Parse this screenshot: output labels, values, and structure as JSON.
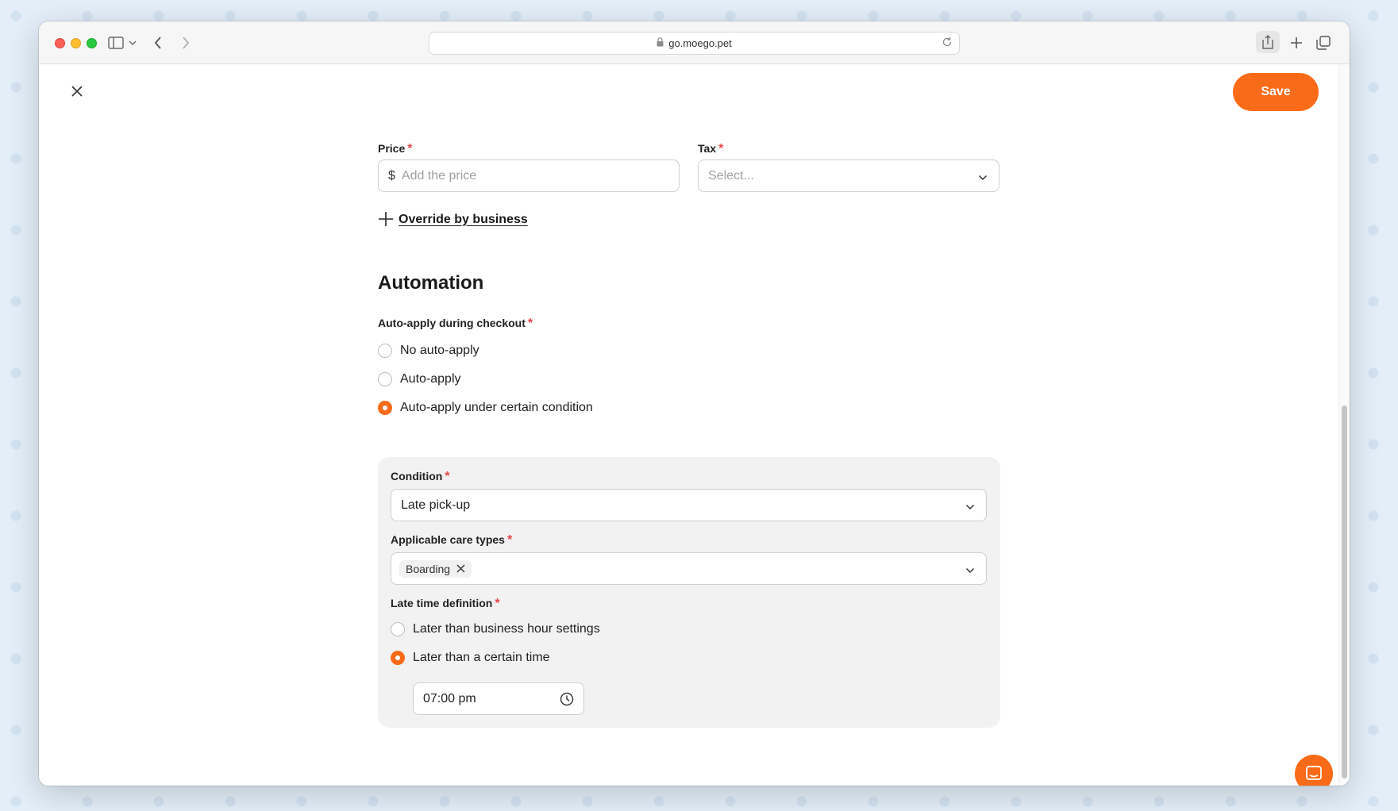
{
  "browser": {
    "url": "go.moego.pet",
    "icons": [
      "sidebar-icon",
      "chevron-down-icon",
      "back-icon",
      "forward-icon",
      "lock-icon",
      "reload-icon",
      "share-icon",
      "new-tab-icon",
      "tabs-overview-icon"
    ]
  },
  "header": {
    "close_icon": "close-icon",
    "save_label": "Save"
  },
  "pricing": {
    "price_label": "Price",
    "price_prefix": "$",
    "price_placeholder": "Add the price",
    "tax_label": "Tax",
    "tax_placeholder": "Select...",
    "override_label": "Override by business"
  },
  "automation": {
    "title": "Automation",
    "auto_apply_label": "Auto-apply during checkout",
    "options": [
      {
        "label": "No auto-apply",
        "checked": false
      },
      {
        "label": "Auto-apply",
        "checked": false
      },
      {
        "label": "Auto-apply under certain condition",
        "checked": true
      }
    ],
    "condition_label": "Condition",
    "condition_value": "Late pick-up",
    "care_types_label": "Applicable care types",
    "care_types": [
      "Boarding"
    ],
    "late_time_label": "Late time definition",
    "late_time_options": [
      {
        "label": "Later than business hour settings",
        "checked": false
      },
      {
        "label": "Later than a certain time",
        "checked": true
      }
    ],
    "time_value": "07:00 pm"
  },
  "colors": {
    "accent": "#f96b18",
    "required": "#e5484d",
    "panel_bg": "#f2f2f2"
  }
}
